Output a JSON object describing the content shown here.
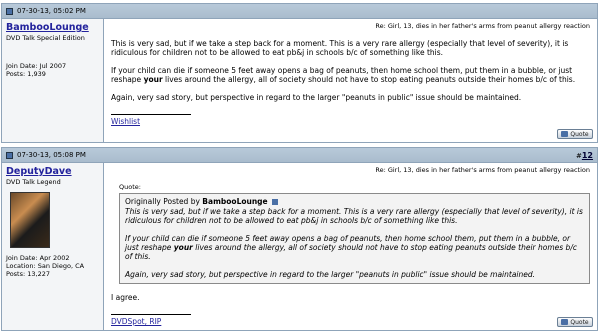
{
  "posts": [
    {
      "date": "07-30-13, 05:02 PM",
      "number": "",
      "author": {
        "name": "BambooLounge",
        "title": "DVD Talk Special Edition",
        "join_date": "Join Date: Jul 2007",
        "location": "",
        "posts": "Posts: 1,939"
      },
      "subject": "Re: Girl, 13, dies in her father's arms from peanut allergy reaction",
      "paragraphs": [
        "This is very sad, but if we take a step back for a moment. This is a very rare allergy (especially that level of severity), it is ridiculous for children not to be allowed to eat pb&j in schools b/c of something like this.",
        "If your child can die if someone 5 feet away opens a bag of peanuts, then home school them, put them in a bubble, or just reshape",
        "Again, very sad story, but perspective in regard to the larger \"peanuts in public\" issue should be maintained."
      ],
      "p2_bold": "your",
      "p2_tail": " lives around the allergy, all of society should not have to stop eating peanuts outside their homes b/c of this.",
      "signature": "Wishlist",
      "quote_button": "Quote"
    },
    {
      "date": "07-30-13, 05:08 PM",
      "number": "12",
      "number_prefix": "#",
      "author": {
        "name": "DeputyDave",
        "title": "DVD Talk Legend",
        "join_date": "Join Date: Apr 2002",
        "location": "Location: San Diego, CA",
        "posts": "Posts: 13,227"
      },
      "subject": "Re: Girl, 13, dies in her father's arms from peanut allergy reaction",
      "quote": {
        "label": "Quote:",
        "originally_posted_by": "Originally Posted by",
        "quoted_author": "BambooLounge",
        "paragraphs": [
          "This is very sad, but if we take a step back for a moment. This is a very rare allergy (especially that level of severity), it is ridiculous for children not to be allowed to eat pb&j in schools b/c of something like this.",
          "If your child can die if someone 5 feet away opens a bag of peanuts, then home school them, put them in a bubble, or just reshape",
          "Again, very sad story, but perspective in regard to the larger \"peanuts in public\" issue should be maintained."
        ],
        "p2_bold": "your",
        "p2_tail": " lives around the allergy, all of society should not have to stop eating peanuts outside their homes b/c of this."
      },
      "reply": "I agree.",
      "signature": "DVDSpot, RIP",
      "quote_button": "Quote"
    }
  ]
}
